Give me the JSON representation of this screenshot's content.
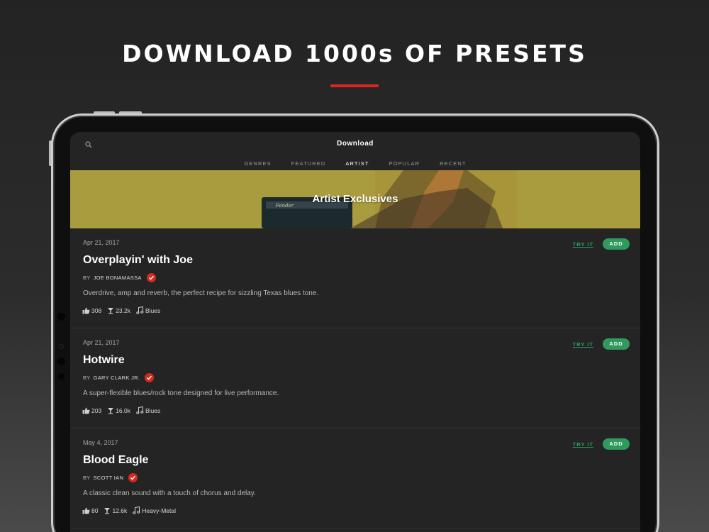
{
  "headline": "DOWNLOAD 1000s OF PRESETS",
  "screen": {
    "title": "Download",
    "tabs": [
      {
        "label": "GENRES",
        "active": false
      },
      {
        "label": "FEATURED",
        "active": false
      },
      {
        "label": "ARTIST",
        "active": true
      },
      {
        "label": "POPULAR",
        "active": false
      },
      {
        "label": "RECENT",
        "active": false
      }
    ],
    "banner_title": "Artist Exclusives"
  },
  "presets": [
    {
      "date": "Apr 21, 2017",
      "name": "Overplayin' with Joe",
      "by": "BY",
      "artist": "JOE BONAMASSA",
      "description": "Overdrive, amp and reverb, the perfect recipe for sizzling Texas blues tone.",
      "likes": "308",
      "downloads": "23.2k",
      "genre": "Blues",
      "try_label": "TRY IT",
      "add_label": "ADD"
    },
    {
      "date": "Apr 21, 2017",
      "name": "Hotwire",
      "by": "BY",
      "artist": "GARY CLARK JR.",
      "description": "A super-flexible blues/rock tone designed for live performance.",
      "likes": "203",
      "downloads": "16.0k",
      "genre": "Blues",
      "try_label": "TRY IT",
      "add_label": "ADD"
    },
    {
      "date": "May 4, 2017",
      "name": "Blood Eagle",
      "by": "BY",
      "artist": "SCOTT IAN",
      "description": "A classic clean sound with a touch of chorus and delay.",
      "likes": "80",
      "downloads": "12.6k",
      "genre": "Heavy-Metal",
      "try_label": "TRY IT",
      "add_label": "ADD"
    }
  ],
  "colors": {
    "accent_red": "#d8291f",
    "add_green": "#2f9a5c",
    "link_green": "#2ba45f"
  }
}
